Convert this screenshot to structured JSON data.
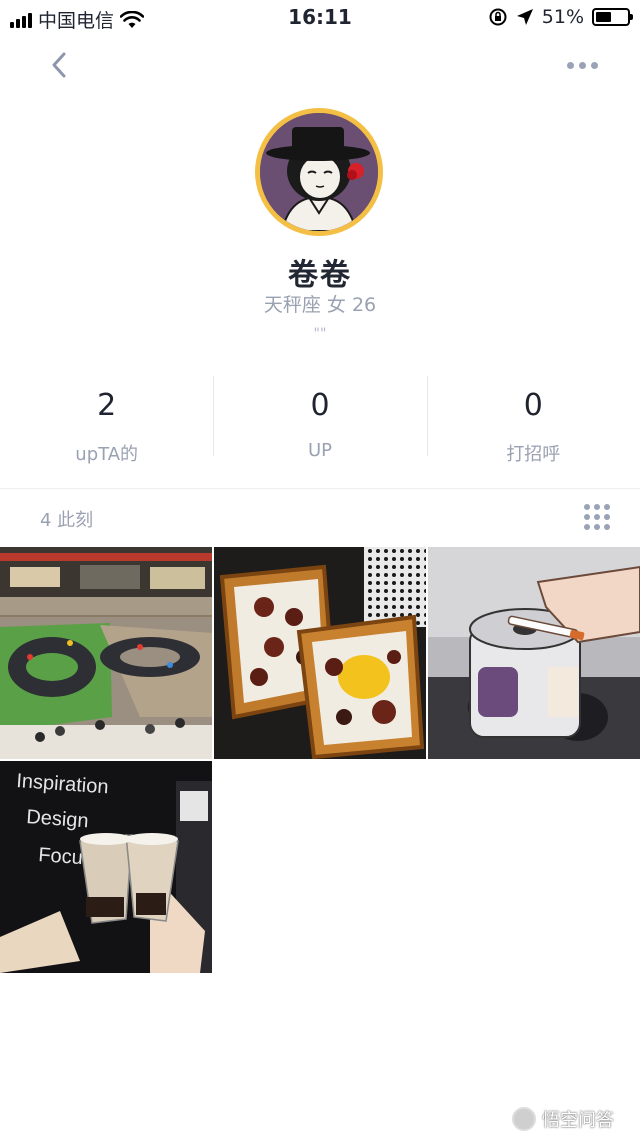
{
  "status_bar": {
    "carrier": "中国电信",
    "time": "16:11",
    "battery": "51%",
    "battery_level": 0.51,
    "wifi_icon": "wifi-icon",
    "location_icon": "location-arrow-icon",
    "lock_icon": "rotation-lock-icon"
  },
  "nav": {
    "back_icon": "chevron-left-icon",
    "more_icon": "more-horizontal-icon"
  },
  "profile": {
    "name": "卷卷",
    "subinfo": "天秤座 女  26",
    "bio": "\"\"",
    "avatar_ring_color": "#f3bf45"
  },
  "stats": [
    {
      "value": "2",
      "label": "upTA的"
    },
    {
      "value": "0",
      "label": "UP"
    },
    {
      "value": "0",
      "label": "打招呼"
    }
  ],
  "moments": {
    "count_label": "4 此刻",
    "grid_icon": "grid-view-icon"
  },
  "photos": [
    {
      "name": "mall-racetrack-photo"
    },
    {
      "name": "inari-sushi-photo"
    },
    {
      "name": "anime-can-photo"
    },
    {
      "name": "bubble-tea-photo",
      "wall_text": [
        "Inspiration",
        "Design",
        "Focus"
      ]
    }
  ],
  "watermark": "悟空问答"
}
